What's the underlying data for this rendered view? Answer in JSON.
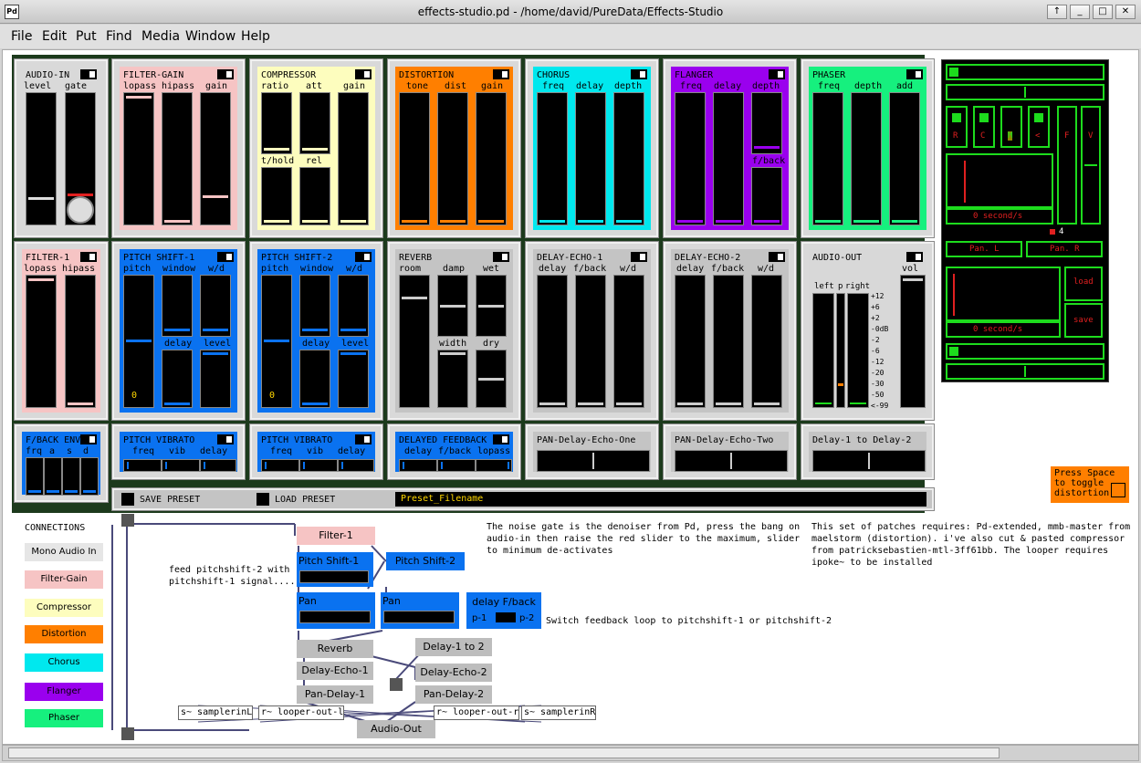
{
  "window": {
    "title": "effects-studio.pd  - /home/david/PureData/Effects-Studio",
    "icon_text": "Pd",
    "buttons": [
      "↑",
      "_",
      "□",
      "✕"
    ]
  },
  "menu": [
    "File",
    "Edit",
    "Put",
    "Find",
    "Media",
    "Window",
    "Help"
  ],
  "colors": {
    "gop_bg": "#1c3a1c",
    "filter_gain": "#f6c4c4",
    "compressor": "#fdfdbe",
    "distortion": "#ff7f00",
    "chorus": "#00e8ee",
    "flanger": "#9a00ee",
    "phaser": "#16f07e",
    "pitch_blue": "#0a72f0",
    "reverb_gray": "#c4c4c4",
    "looper_green": "#1ddc1d",
    "looper_red": "#e02020",
    "audio_out": "#d8d8d8"
  },
  "modules": {
    "audio_in": {
      "name": "AUDIO-IN",
      "l1": "level",
      "l2": "gate"
    },
    "filter_gain": {
      "name": "FILTER-GAIN",
      "l1": "lopass",
      "l2": "hipass",
      "l3": "gain"
    },
    "compressor": {
      "name": "COMPRESSOR",
      "l1": "ratio",
      "l2": "att",
      "l3": "gain",
      "l4": "t/hold",
      "l5": "rel"
    },
    "distortion": {
      "name": "DISTORTION",
      "l1": "tone",
      "l2": "dist",
      "l3": "gain"
    },
    "chorus": {
      "name": "CHORUS",
      "l1": "freq",
      "l2": "delay",
      "l3": "depth"
    },
    "flanger": {
      "name": "FLANGER",
      "l1": "freq",
      "l2": "delay",
      "l3": "depth",
      "l4": "f/back"
    },
    "phaser": {
      "name": "PHASER",
      "l1": "freq",
      "l2": "depth",
      "l3": "add"
    },
    "filter1": {
      "name": "FILTER-1",
      "l1": "lopass",
      "l2": "hipass"
    },
    "pitch1": {
      "name": "PITCH SHIFT-1",
      "l1": "pitch",
      "l2": "window",
      "l3": "w/d",
      "l4": "delay",
      "l5": "level",
      "num": "0"
    },
    "pitch2": {
      "name": "PITCH SHIFT-2",
      "l1": "pitch",
      "l2": "window",
      "l3": "w/d",
      "l4": "delay",
      "l5": "level",
      "num": "0"
    },
    "reverb": {
      "name": "REVERB",
      "l1": "room",
      "l2": "damp",
      "l3": "wet",
      "l4": "width",
      "l5": "dry"
    },
    "delay1": {
      "name": "DELAY-ECHO-1",
      "l1": "delay",
      "l2": "f/back",
      "l3": "w/d"
    },
    "delay2": {
      "name": "DELAY-ECHO-2",
      "l1": "delay",
      "l2": "f/back",
      "l3": "w/d"
    },
    "audio_out": {
      "name": "AUDIO-OUT",
      "l1": "vol",
      "left": "left",
      "p": "p",
      "right": "right",
      "scale": [
        "+12",
        "+6",
        "+2",
        "-0dB",
        "-2",
        "-6",
        "-12",
        "-20",
        "-30",
        "-50",
        "<-99"
      ]
    },
    "fback_env": {
      "name": "F/BACK ENV",
      "l1": "frq",
      "l2": "a",
      "l3": "s",
      "l4": "d"
    },
    "vibrato1": {
      "name": "PITCH VIBRATO",
      "l1": "freq",
      "l2": "vib",
      "l3": "delay"
    },
    "vibrato2": {
      "name": "PITCH VIBRATO",
      "l1": "freq",
      "l2": "vib",
      "l3": "delay"
    },
    "delayed_fb": {
      "name": "DELAYED FEEDBACK",
      "l1": "delay",
      "l2": "f/back",
      "l3": "lopass"
    },
    "pan_de1": {
      "name": "PAN-Delay-Echo-One"
    },
    "pan_de2": {
      "name": "PAN-Delay-Echo-Two"
    },
    "d1_to_d2": {
      "name": "Delay-1 to Delay-2"
    }
  },
  "presets": {
    "save": "SAVE PRESET",
    "load": "LOAD PRESET",
    "filename": "Preset_Filename"
  },
  "looper": {
    "r": "R",
    "c": "C",
    "m": "M",
    "lt": "<",
    "f": "F",
    "v": "V",
    "rate1": "0    second/s",
    "rate2": "0    second/s",
    "pan_l": "Pan. L",
    "pan_r": "Pan. R",
    "load": "load",
    "save": "save",
    "four": "4"
  },
  "toggle_hint": "Press Space\nto toggle\ndistortion",
  "connections": {
    "title": "CONNECTIONS",
    "items": [
      "Mono Audio In",
      "Filter-Gain",
      "Compressor",
      "Distortion",
      "Chorus",
      "Flanger",
      "Phaser"
    ]
  },
  "patch": {
    "filter1": "Filter-1",
    "ps1": "Pitch Shift-1",
    "ps2": "Pitch Shift-2",
    "pan1": "Pan",
    "pan2": "Pan",
    "delay_fb": "delay F/back",
    "p1": "p-1",
    "p2": "p-2",
    "reverb": "Reverb",
    "d1to2": "Delay-1 to 2",
    "de1": "Delay-Echo-1",
    "de2": "Delay-Echo-2",
    "pd1": "Pan-Delay-1",
    "pd2": "Pan-Delay-2",
    "audio_out": "Audio-Out",
    "s_l": "s~ samplerinL",
    "r_l": "r~ looper-out-l",
    "r_r": "r~ looper-out-r",
    "s_r": "s~ samplerinR"
  },
  "comments": {
    "feed": "feed pitchshift-2 with\npitchshift-1 signal....",
    "switch": "Switch feedback loop to pitchshift-1 or pitchshift-2",
    "noise": "The noise gate is the denoiser from Pd, press the bang on\naudio-in then raise the red slider to the maximum, slider\nto minimum de-activates",
    "requires": "This set of patches requires: Pd-extended, mmb-master from\nmaelstorm (distortion). i've also cut & pasted compressor\nfrom patricksebastien-mtl-3ff61bb. The looper requires\nipoke~ to be installed"
  }
}
